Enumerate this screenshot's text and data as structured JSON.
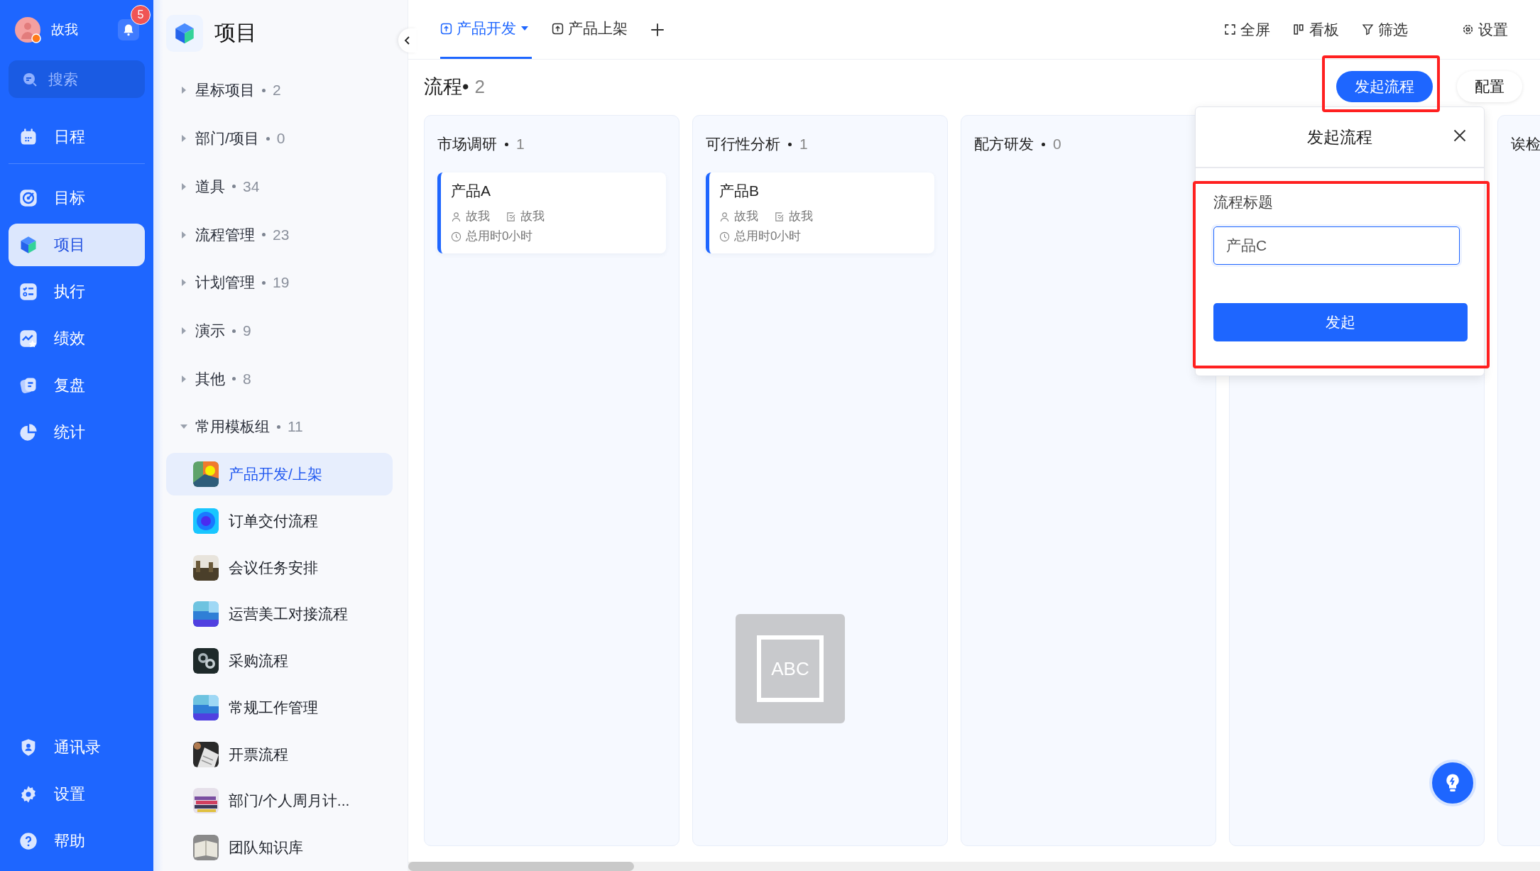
{
  "user": {
    "name": "故我",
    "notifications": "5"
  },
  "search": {
    "placeholder": "搜索"
  },
  "nav": {
    "items": [
      {
        "label": "日程",
        "selected": false
      },
      {
        "label": "目标",
        "selected": false
      },
      {
        "label": "项目",
        "selected": true
      },
      {
        "label": "执行",
        "selected": false
      },
      {
        "label": "绩效",
        "selected": false
      },
      {
        "label": "复盘",
        "selected": false
      },
      {
        "label": "统计",
        "selected": false
      }
    ],
    "bottom_items": [
      {
        "label": "通讯录",
        "selected": false
      },
      {
        "label": "设置",
        "selected": false
      },
      {
        "label": "帮助",
        "selected": false
      }
    ]
  },
  "project_panel": {
    "title": "项目",
    "groups": [
      {
        "label": "星标项目",
        "count": "2",
        "expanded": false
      },
      {
        "label": "部门/项目",
        "count": "0",
        "expanded": false
      },
      {
        "label": "道具",
        "count": "34",
        "expanded": false
      },
      {
        "label": "流程管理",
        "count": "23",
        "expanded": false
      },
      {
        "label": "计划管理",
        "count": "19",
        "expanded": false
      },
      {
        "label": "演示",
        "count": "9",
        "expanded": false
      },
      {
        "label": "其他",
        "count": "8",
        "expanded": false
      },
      {
        "label": "常用模板组",
        "count": "11",
        "expanded": true,
        "children": [
          {
            "label": "产品开发/上架",
            "selected": true
          },
          {
            "label": "订单交付流程",
            "selected": false
          },
          {
            "label": "会议任务安排",
            "selected": false
          },
          {
            "label": "运营美工对接流程",
            "selected": false
          },
          {
            "label": "采购流程",
            "selected": false
          },
          {
            "label": "常规工作管理",
            "selected": false
          },
          {
            "label": "开票流程",
            "selected": false
          },
          {
            "label": "部门/个人周月计...",
            "selected": false
          },
          {
            "label": "团队知识库",
            "selected": false
          }
        ]
      }
    ]
  },
  "tabs": [
    {
      "label": "产品开发",
      "selected": true,
      "dropdown": true
    },
    {
      "label": "产品上架",
      "selected": false,
      "dropdown": false
    }
  ],
  "toolbar": [
    "全屏",
    "看板",
    "筛选",
    "设置"
  ],
  "board": {
    "title": "流程•",
    "count": "2",
    "buttons": [
      "发起流程",
      "配置"
    ],
    "columns": [
      {
        "title": "市场调研",
        "count": "1",
        "cards": [
          {
            "title": "产品A",
            "owner": "故我",
            "editor": "故我",
            "time": "总用时0小时"
          }
        ]
      },
      {
        "title": "可行性分析",
        "count": "1",
        "cards": [
          {
            "title": "产品B",
            "owner": "故我",
            "editor": "故我",
            "time": "总用时0小时"
          }
        ]
      },
      {
        "title": "配方研发",
        "count": "0"
      },
      {},
      {
        "title": "诶检"
      }
    ]
  },
  "dialog": {
    "title": "发起流程",
    "field_label": "流程标题",
    "value": "产品C",
    "submit": "发起"
  },
  "ime_indicator": "ABC"
}
